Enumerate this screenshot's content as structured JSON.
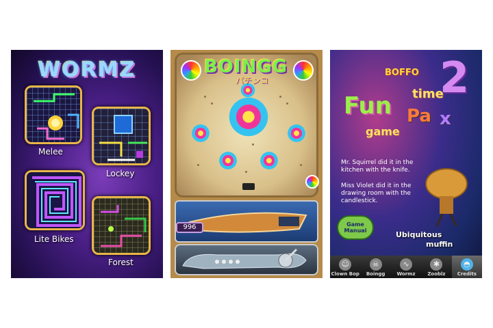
{
  "wormz": {
    "logo": "WORMZ",
    "tiles": [
      {
        "label": "Melee"
      },
      {
        "label": "Lockey"
      },
      {
        "label": "Lite Bikes"
      },
      {
        "label": "Forest"
      }
    ]
  },
  "boingg": {
    "logo": "BOINGG",
    "subtitle": "パチンコ",
    "counter": "996"
  },
  "funpax": {
    "title_small": "BOFFO",
    "title_number": "2",
    "word_time": "time",
    "word_fun": "Fun",
    "word_pa": "Pa",
    "word_x": "x",
    "word_game": "game",
    "clue1": "Mr. Squirrel did it in the kitchen with the knife.",
    "clue2": "Miss Violet did it in the drawing room with the candlestick.",
    "manual_label": "Game Manual",
    "character_label_1": "Ubiquitous",
    "character_label_2": "muffin",
    "tabs": [
      {
        "label": "Clown Bop",
        "icon": "clown-icon"
      },
      {
        "label": "Boingg",
        "icon": "skull-icon"
      },
      {
        "label": "Wormz",
        "icon": "worm-icon"
      },
      {
        "label": "Zooblz",
        "icon": "bug-icon"
      },
      {
        "label": "Credits",
        "icon": "cupcake-icon"
      }
    ],
    "active_tab": "Credits"
  }
}
